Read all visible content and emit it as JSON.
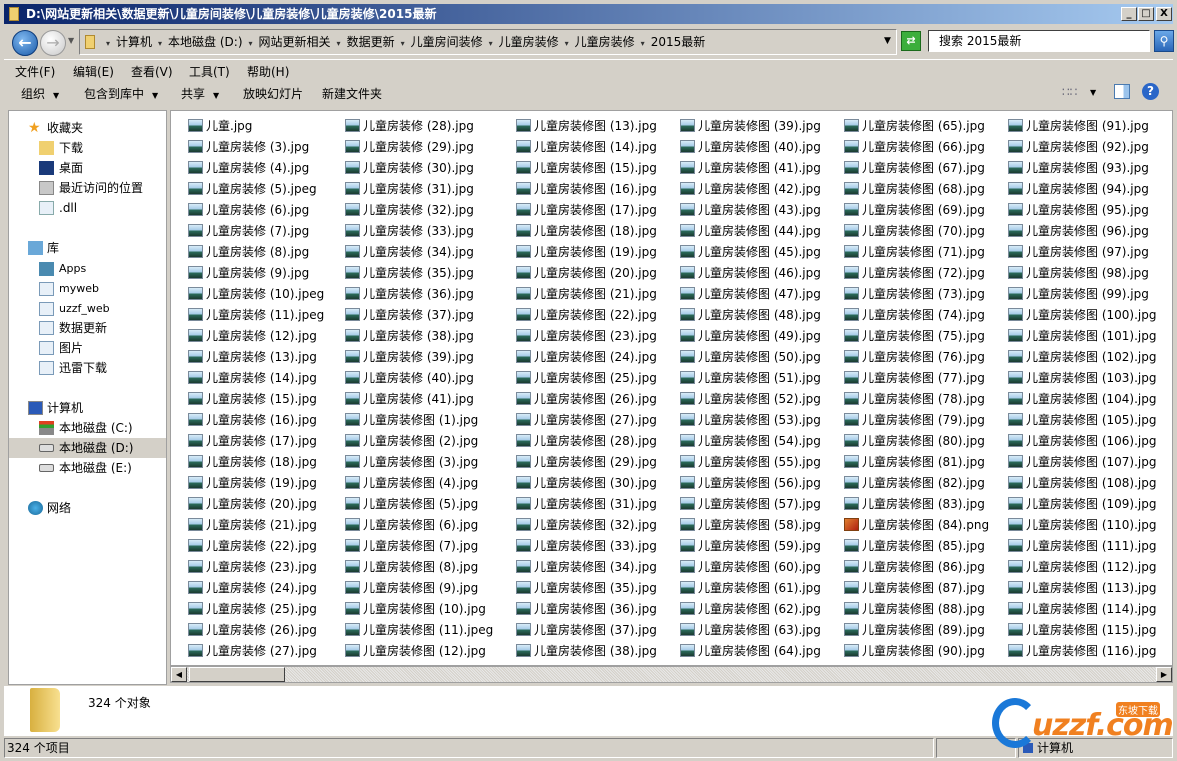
{
  "window": {
    "title": "D:\\网站更新相关\\数据更新\\儿童房间装修\\儿童房装修\\儿童房装修\\2015最新",
    "minimize": "_",
    "maximize": "□",
    "close": "X"
  },
  "address": {
    "crumbs": [
      "计算机",
      "本地磁盘 (D:)",
      "网站更新相关",
      "数据更新",
      "儿童房间装修",
      "儿童房装修",
      "儿童房装修",
      "2015最新"
    ],
    "search_placeholder": "搜索 2015最新"
  },
  "menu": [
    "文件(F)",
    "编辑(E)",
    "查看(V)",
    "工具(T)",
    "帮助(H)"
  ],
  "toolbar": {
    "organize": "组织",
    "include": "包含到库中",
    "share": "共享",
    "slideshow": "放映幻灯片",
    "new_folder": "新建文件夹"
  },
  "nav": {
    "favorites": "收藏夹",
    "downloads": "下载",
    "desktop": "桌面",
    "recent": "最近访问的位置",
    "dll": ".dll",
    "libraries": "库",
    "apps": "Apps",
    "myweb": "myweb",
    "uzzf_web": "uzzf_web",
    "data_update": "数据更新",
    "pictures": "图片",
    "xunlei": "迅雷下载",
    "computer": "计算机",
    "drive_c": "本地磁盘 (C:)",
    "drive_d": "本地磁盘 (D:)",
    "drive_e": "本地磁盘 (E:)",
    "network": "网络"
  },
  "files": [
    [
      "儿童.jpg",
      "儿童房装修 (3).jpg",
      "儿童房装修 (4).jpg",
      "儿童房装修 (5).jpeg",
      "儿童房装修 (6).jpg",
      "儿童房装修 (7).jpg",
      "儿童房装修 (8).jpg",
      "儿童房装修 (9).jpg",
      "儿童房装修 (10).jpeg",
      "儿童房装修 (11).jpeg",
      "儿童房装修 (12).jpg",
      "儿童房装修 (13).jpg",
      "儿童房装修 (14).jpg",
      "儿童房装修 (15).jpg",
      "儿童房装修 (16).jpg",
      "儿童房装修 (17).jpg",
      "儿童房装修 (18).jpg",
      "儿童房装修 (19).jpg",
      "儿童房装修 (20).jpg",
      "儿童房装修 (21).jpg",
      "儿童房装修 (22).jpg",
      "儿童房装修 (23).jpg",
      "儿童房装修 (24).jpg",
      "儿童房装修 (25).jpg",
      "儿童房装修 (26).jpg",
      "儿童房装修 (27).jpg"
    ],
    [
      "儿童房装修 (28).jpg",
      "儿童房装修 (29).jpg",
      "儿童房装修 (30).jpg",
      "儿童房装修 (31).jpg",
      "儿童房装修 (32).jpg",
      "儿童房装修 (33).jpg",
      "儿童房装修 (34).jpg",
      "儿童房装修 (35).jpg",
      "儿童房装修 (36).jpg",
      "儿童房装修 (37).jpg",
      "儿童房装修 (38).jpg",
      "儿童房装修 (39).jpg",
      "儿童房装修 (40).jpg",
      "儿童房装修 (41).jpg",
      "儿童房装修图 (1).jpg",
      "儿童房装修图 (2).jpg",
      "儿童房装修图 (3).jpg",
      "儿童房装修图 (4).jpg",
      "儿童房装修图 (5).jpg",
      "儿童房装修图 (6).jpg",
      "儿童房装修图 (7).jpg",
      "儿童房装修图 (8).jpg",
      "儿童房装修图 (9).jpg",
      "儿童房装修图 (10).jpg",
      "儿童房装修图 (11).jpeg",
      "儿童房装修图 (12).jpg"
    ],
    [
      "儿童房装修图 (13).jpg",
      "儿童房装修图 (14).jpg",
      "儿童房装修图 (15).jpg",
      "儿童房装修图 (16).jpg",
      "儿童房装修图 (17).jpg",
      "儿童房装修图 (18).jpg",
      "儿童房装修图 (19).jpg",
      "儿童房装修图 (20).jpg",
      "儿童房装修图 (21).jpg",
      "儿童房装修图 (22).jpg",
      "儿童房装修图 (23).jpg",
      "儿童房装修图 (24).jpg",
      "儿童房装修图 (25).jpg",
      "儿童房装修图 (26).jpg",
      "儿童房装修图 (27).jpg",
      "儿童房装修图 (28).jpg",
      "儿童房装修图 (29).jpg",
      "儿童房装修图 (30).jpg",
      "儿童房装修图 (31).jpg",
      "儿童房装修图 (32).jpg",
      "儿童房装修图 (33).jpg",
      "儿童房装修图 (34).jpg",
      "儿童房装修图 (35).jpg",
      "儿童房装修图 (36).jpg",
      "儿童房装修图 (37).jpg",
      "儿童房装修图 (38).jpg"
    ],
    [
      "儿童房装修图 (39).jpg",
      "儿童房装修图 (40).jpg",
      "儿童房装修图 (41).jpg",
      "儿童房装修图 (42).jpg",
      "儿童房装修图 (43).jpg",
      "儿童房装修图 (44).jpg",
      "儿童房装修图 (45).jpg",
      "儿童房装修图 (46).jpg",
      "儿童房装修图 (47).jpg",
      "儿童房装修图 (48).jpg",
      "儿童房装修图 (49).jpg",
      "儿童房装修图 (50).jpg",
      "儿童房装修图 (51).jpg",
      "儿童房装修图 (52).jpg",
      "儿童房装修图 (53).jpg",
      "儿童房装修图 (54).jpg",
      "儿童房装修图 (55).jpg",
      "儿童房装修图 (56).jpg",
      "儿童房装修图 (57).jpg",
      "儿童房装修图 (58).jpg",
      "儿童房装修图 (59).jpg",
      "儿童房装修图 (60).jpg",
      "儿童房装修图 (61).jpg",
      "儿童房装修图 (62).jpg",
      "儿童房装修图 (63).jpg",
      "儿童房装修图 (64).jpg"
    ],
    [
      "儿童房装修图 (65).jpg",
      "儿童房装修图 (66).jpg",
      "儿童房装修图 (67).jpg",
      "儿童房装修图 (68).jpg",
      "儿童房装修图 (69).jpg",
      "儿童房装修图 (70).jpg",
      "儿童房装修图 (71).jpg",
      "儿童房装修图 (72).jpg",
      "儿童房装修图 (73).jpg",
      "儿童房装修图 (74).jpg",
      "儿童房装修图 (75).jpg",
      "儿童房装修图 (76).jpg",
      "儿童房装修图 (77).jpg",
      "儿童房装修图 (78).jpg",
      "儿童房装修图 (79).jpg",
      "儿童房装修图 (80).jpg",
      "儿童房装修图 (81).jpg",
      "儿童房装修图 (82).jpg",
      "儿童房装修图 (83).jpg",
      "儿童房装修图 (84).png",
      "儿童房装修图 (85).jpg",
      "儿童房装修图 (86).jpg",
      "儿童房装修图 (87).jpg",
      "儿童房装修图 (88).jpg",
      "儿童房装修图 (89).jpg",
      "儿童房装修图 (90).jpg"
    ],
    [
      "儿童房装修图 (91).jpg",
      "儿童房装修图 (92).jpg",
      "儿童房装修图 (93).jpg",
      "儿童房装修图 (94).jpg",
      "儿童房装修图 (95).jpg",
      "儿童房装修图 (96).jpg",
      "儿童房装修图 (97).jpg",
      "儿童房装修图 (98).jpg",
      "儿童房装修图 (99).jpg",
      "儿童房装修图 (100).jpg",
      "儿童房装修图 (101).jpg",
      "儿童房装修图 (102).jpg",
      "儿童房装修图 (103).jpg",
      "儿童房装修图 (104).jpg",
      "儿童房装修图 (105).jpg",
      "儿童房装修图 (106).jpg",
      "儿童房装修图 (107).jpg",
      "儿童房装修图 (108).jpg",
      "儿童房装修图 (109).jpg",
      "儿童房装修图 (110).jpg",
      "儿童房装修图 (111).jpg",
      "儿童房装修图 (112).jpg",
      "儿童房装修图 (113).jpg",
      "儿童房装修图 (114).jpg",
      "儿童房装修图 (115).jpg",
      "儿童房装修图 (116).jpg"
    ]
  ],
  "details": {
    "count": "324 个对象"
  },
  "status": {
    "items": "324 个项目",
    "location": "计算机"
  },
  "watermark": {
    "text": "uzzf.com",
    "tag": "东坡下载"
  },
  "colors": {
    "title_start": "#0a246a",
    "title_end": "#a6caf0",
    "chrome": "#d4d0c8"
  }
}
